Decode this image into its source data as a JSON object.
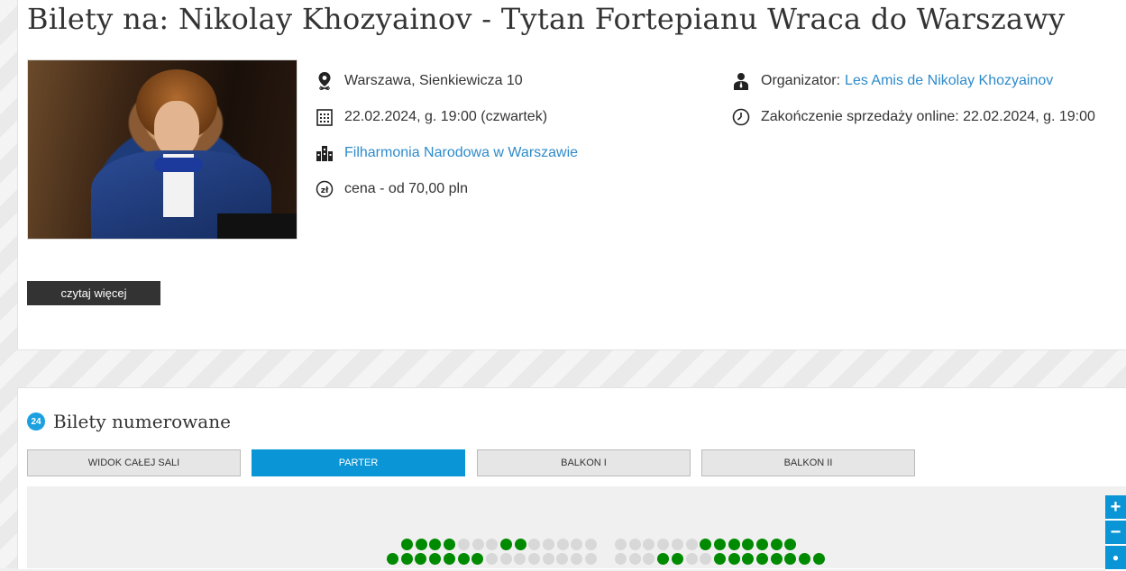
{
  "event": {
    "title": "Bilety na: Nikolay Khozyainov - Tytan Fortepianu Wraca do Warszawy",
    "address": "Warszawa, Sienkiewicza 10",
    "datetime": "22.02.2024, g. 19:00 (czwartek)",
    "venue": "Filharmonia Narodowa w Warszawie",
    "price": "cena - od 70,00 pln",
    "organizer_label": "Organizator:",
    "organizer_name": "Les Amis de Nikolay Khozyainov",
    "sale_end": "Zakończenie sprzedaży online: 22.02.2024, g. 19:00",
    "read_more": "czytaj więcej"
  },
  "tickets": {
    "badge": "24",
    "title": "Bilety numerowane",
    "tabs": [
      {
        "label": "WIDOK CAŁEJ SALI",
        "active": false
      },
      {
        "label": "PARTER",
        "active": true
      },
      {
        "label": "BALKON I",
        "active": false
      },
      {
        "label": "BALKON II",
        "active": false
      }
    ]
  },
  "zoom": {
    "plus": "+",
    "minus": "−"
  },
  "colors": {
    "accent": "#0a96d6",
    "available_seat": "#008a00",
    "taken_seat": "#d8d8d8",
    "link": "#2f8bc9"
  },
  "seat_rows": [
    {
      "block": "left",
      "status": "ggggxxxggxxxxx"
    },
    {
      "block": "left",
      "status": "gggggggxxxxxxxx"
    },
    {
      "block": "right",
      "status": "xxxxxxggggggg"
    },
    {
      "block": "right",
      "status": "xxxggxxgggggggg"
    }
  ]
}
